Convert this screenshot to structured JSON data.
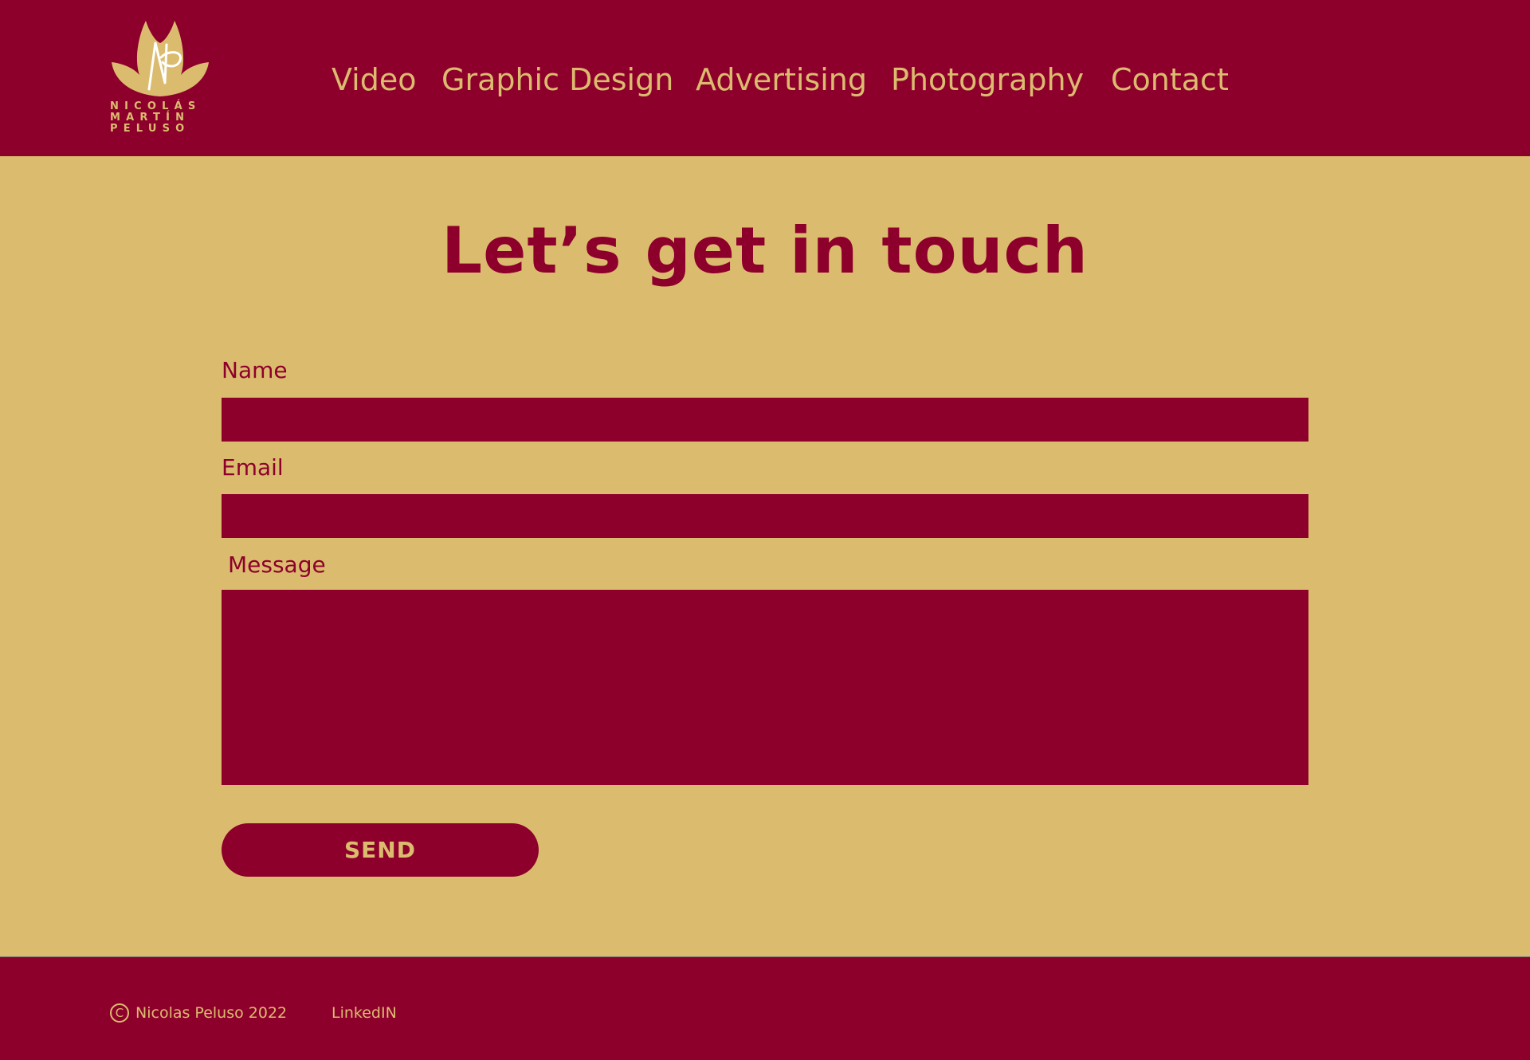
{
  "brand": {
    "logo_monogram": "NP",
    "logo_lines": [
      "NICOLÁS",
      "MARTÍN",
      "PELUSO"
    ]
  },
  "nav": {
    "items": [
      "Video",
      "Graphic Design",
      "Advertising",
      "Photography",
      "Contact"
    ]
  },
  "main": {
    "title": "Let’s get in touch",
    "form": {
      "name_label": "Name",
      "email_label": "Email",
      "message_label": "Message",
      "send_label": "SEND"
    }
  },
  "footer": {
    "copyright_symbol": "C",
    "copyright_text": "Nicolas Peluso 2022",
    "link": "LinkedIN"
  },
  "colors": {
    "primary": "#8e002c",
    "accent": "#dbbc6f"
  }
}
